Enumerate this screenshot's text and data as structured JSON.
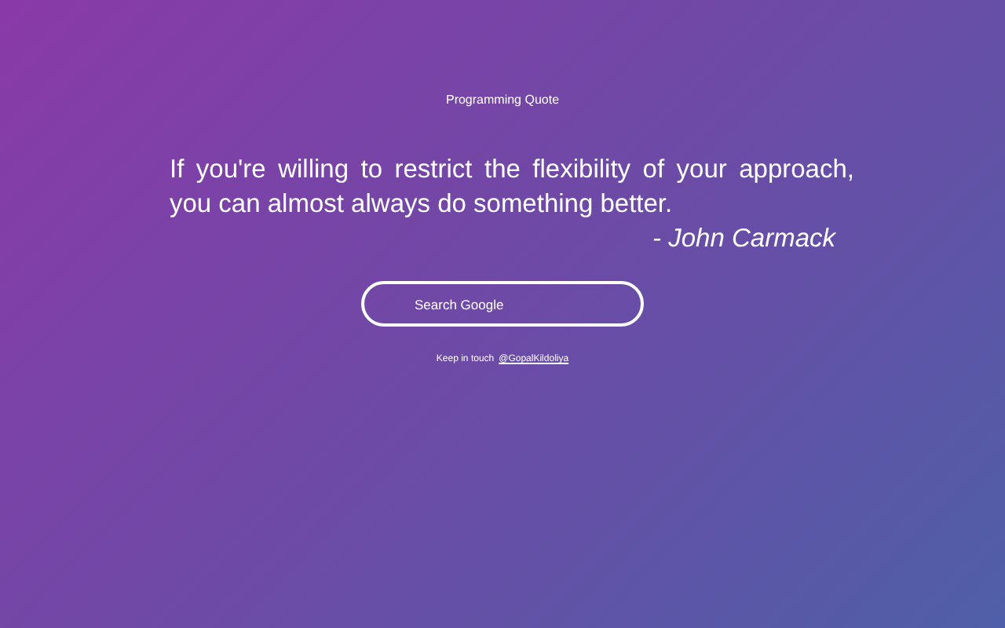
{
  "heading": "Programming Quote",
  "quote": {
    "text": "If you're willing to restrict the flexibility of your approach, you can almost always do something better.",
    "author": "- John Carmack"
  },
  "search": {
    "placeholder": "Search Google"
  },
  "footer": {
    "text": "Keep in touch",
    "link": "@GopalKildoliya"
  }
}
